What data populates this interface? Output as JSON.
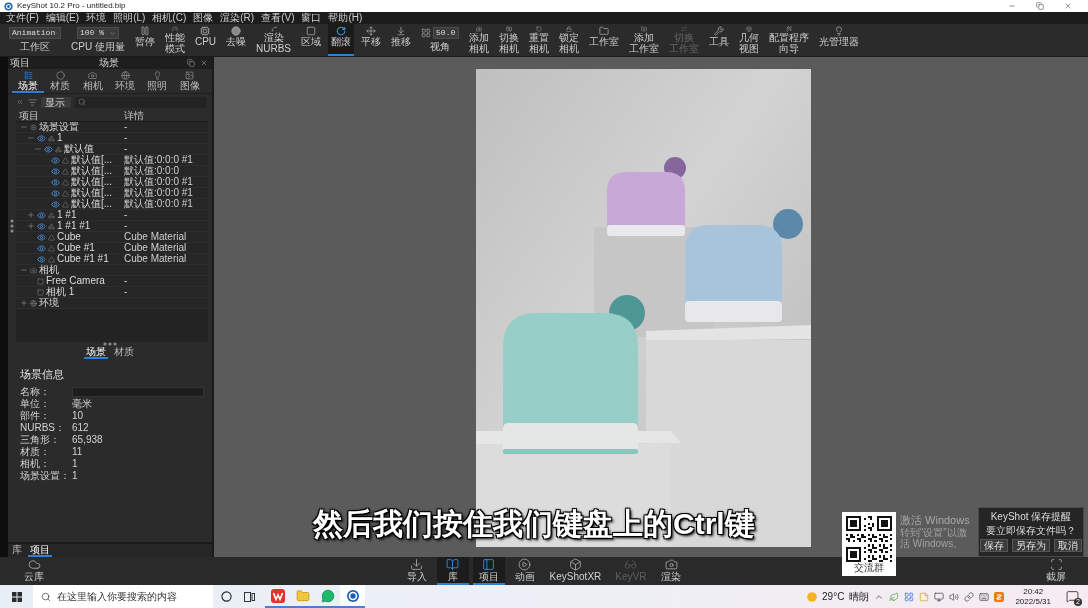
{
  "window": {
    "title": "KeyShot 10.2 Pro - untitled.bip"
  },
  "menu": [
    "文件(F)",
    "编辑(E)",
    "环境",
    "照明(L)",
    "相机(C)",
    "图像",
    "渲染(R)",
    "查看(V)",
    "窗口",
    "帮助(H)"
  ],
  "toolbar": {
    "items": [
      {
        "kind": "dropdown",
        "value": "Animation",
        "label": "工作区"
      },
      {
        "kind": "dropdown",
        "value": "100 %",
        "label": "CPU 使用量"
      },
      {
        "kind": "button",
        "label": "暂停",
        "selected": false,
        "disabled": false
      },
      {
        "kind": "button",
        "label": "性能模式",
        "selected": false,
        "disabled": false
      },
      {
        "kind": "button",
        "label": "CPU",
        "selected": false,
        "disabled": false
      },
      {
        "kind": "button",
        "label": "去噪",
        "selected": false,
        "disabled": false
      },
      {
        "kind": "button",
        "label": "渲染NURBS",
        "selected": false,
        "disabled": false
      },
      {
        "kind": "button",
        "label": "区域",
        "selected": false,
        "disabled": false
      },
      {
        "kind": "button",
        "label": "翻滚",
        "selected": true,
        "disabled": false
      },
      {
        "kind": "button",
        "label": "平移",
        "selected": false,
        "disabled": false
      },
      {
        "kind": "button",
        "label": "推移",
        "selected": false,
        "disabled": false
      },
      {
        "kind": "field",
        "value": "50.0",
        "label": "视角"
      },
      {
        "kind": "button",
        "label": "添加相机",
        "selected": false,
        "disabled": false
      },
      {
        "kind": "button",
        "label": "切换相机",
        "selected": false,
        "disabled": false
      },
      {
        "kind": "button",
        "label": "重置相机",
        "selected": false,
        "disabled": false
      },
      {
        "kind": "button",
        "label": "锁定相机",
        "selected": false,
        "disabled": false
      },
      {
        "kind": "button",
        "label": "工作室",
        "selected": false,
        "disabled": false
      },
      {
        "kind": "button",
        "label": "添加工作室",
        "selected": false,
        "disabled": false
      },
      {
        "kind": "button",
        "label": "切换工作室",
        "selected": false,
        "disabled": true
      },
      {
        "kind": "button",
        "label": "工具",
        "selected": false,
        "disabled": false
      },
      {
        "kind": "button",
        "label": "几何视图",
        "selected": false,
        "disabled": false
      },
      {
        "kind": "button",
        "label": "配置程序向导",
        "selected": false,
        "disabled": false
      },
      {
        "kind": "button",
        "label": "光管理器",
        "selected": false,
        "disabled": false
      }
    ]
  },
  "left_panel": {
    "dock_label": "项目",
    "title": "场景",
    "tabs": [
      {
        "label": "场景",
        "selected": true
      },
      {
        "label": "材质",
        "selected": false
      },
      {
        "label": "相机",
        "selected": false
      },
      {
        "label": "环境",
        "selected": false
      },
      {
        "label": "照明",
        "selected": false
      },
      {
        "label": "图像",
        "selected": false
      }
    ],
    "filter": {
      "value": "显示"
    },
    "columns": [
      "项目",
      "详情"
    ],
    "tree": [
      {
        "label": "场景设置",
        "detail": "-",
        "kind": "settings",
        "expanded": true,
        "children": [
          {
            "label": "1",
            "detail": "-",
            "kind": "model",
            "visible": true,
            "expanded": true,
            "children": [
              {
                "label": "默认值",
                "detail": "-",
                "kind": "model",
                "visible": true,
                "expanded": true,
                "children": [
                  {
                    "label": "默认值[...",
                    "detail": "默认值:0:0:0 #1",
                    "kind": "part",
                    "visible": true
                  },
                  {
                    "label": "默认值[...",
                    "detail": "默认值:0:0:0",
                    "kind": "part",
                    "visible": true
                  },
                  {
                    "label": "默认值[...",
                    "detail": "默认值:0:0:0 #1",
                    "kind": "part",
                    "visible": true
                  },
                  {
                    "label": "默认值[...",
                    "detail": "默认值:0:0:0 #1",
                    "kind": "part",
                    "visible": true
                  },
                  {
                    "label": "默认值[...",
                    "detail": "默认值:0:0:0 #1",
                    "kind": "part",
                    "visible": true
                  }
                ]
              }
            ]
          },
          {
            "label": "1 #1",
            "detail": "-",
            "kind": "model",
            "visible": true,
            "expanded": false
          },
          {
            "label": "1 #1 #1",
            "detail": "-",
            "kind": "model",
            "visible": true,
            "expanded": false
          },
          {
            "label": "Cube",
            "detail": "Cube Material",
            "kind": "part",
            "visible": true
          },
          {
            "label": "Cube #1",
            "detail": "Cube Material",
            "kind": "part",
            "visible": true
          },
          {
            "label": "Cube #1 #1",
            "detail": "Cube Material",
            "kind": "part",
            "visible": true
          }
        ]
      },
      {
        "label": "相机",
        "kind": "camera_group",
        "expanded": true,
        "children": [
          {
            "label": "Free Camera",
            "detail": "-",
            "kind": "camera"
          },
          {
            "label": "相机 1",
            "detail": "-",
            "kind": "camera"
          }
        ]
      },
      {
        "label": "环境",
        "kind": "environment",
        "expanded": false
      }
    ],
    "scene_tabs": [
      {
        "label": "场景",
        "selected": true
      },
      {
        "label": "材质",
        "selected": false
      }
    ],
    "scene_info": {
      "title": "场景信息",
      "rows": [
        {
          "label": "名称：",
          "kind": "input"
        },
        {
          "label": "单位：",
          "value": "毫米",
          "kind": "text"
        },
        {
          "label": "部件：",
          "value": "10",
          "kind": "text"
        },
        {
          "label": "NURBS：",
          "value": "612",
          "kind": "text"
        },
        {
          "label": "三角形：",
          "value": "65,938",
          "kind": "text"
        },
        {
          "label": "材质：",
          "value": "11",
          "kind": "text"
        },
        {
          "label": "相机：",
          "value": "1",
          "kind": "text"
        },
        {
          "label": "场景设置：",
          "value": "1",
          "kind": "text"
        }
      ]
    },
    "footer_tabs": [
      {
        "label": "库",
        "selected": false
      },
      {
        "label": "项目",
        "selected": true
      }
    ]
  },
  "viewport": {
    "subtitle": "然后我们按住我们键盘上的Ctrl键",
    "qr_card": {
      "caption": "交流群"
    },
    "activation_notice": {
      "title": "激活 Windows",
      "text": "转到“设置”以激活 Windows。"
    },
    "dialog": {
      "title": "KeyShot 保存提醒",
      "message": "要立即保存文件吗？",
      "buttons": [
        "保存",
        "另存为",
        "取消"
      ]
    }
  },
  "bottom_bar": {
    "left": {
      "label": "云库"
    },
    "items": [
      {
        "label": "导入",
        "selected": false,
        "disabled": false
      },
      {
        "label": "库",
        "selected": true,
        "disabled": false
      },
      {
        "label": "项目",
        "selected": true,
        "disabled": false
      },
      {
        "label": "动画",
        "selected": false,
        "disabled": false
      },
      {
        "label": "KeyShotXR",
        "selected": false,
        "disabled": false
      },
      {
        "label": "KeyVR",
        "selected": false,
        "disabled": true
      },
      {
        "label": "渲染",
        "selected": false,
        "disabled": false
      }
    ],
    "right": {
      "label": "截屏"
    }
  },
  "taskbar": {
    "search": {
      "placeholder": "在这里输入你要搜索的内容"
    },
    "apps": [
      {
        "selected": false
      },
      {
        "selected": false
      },
      {
        "selected": false
      },
      {
        "selected": true
      }
    ],
    "weather": {
      "temperature": "29°C",
      "condition": "晴朗"
    },
    "clock": {
      "time": "20:42",
      "date": "2022/5/31"
    },
    "notifications": {
      "count": "2"
    }
  }
}
